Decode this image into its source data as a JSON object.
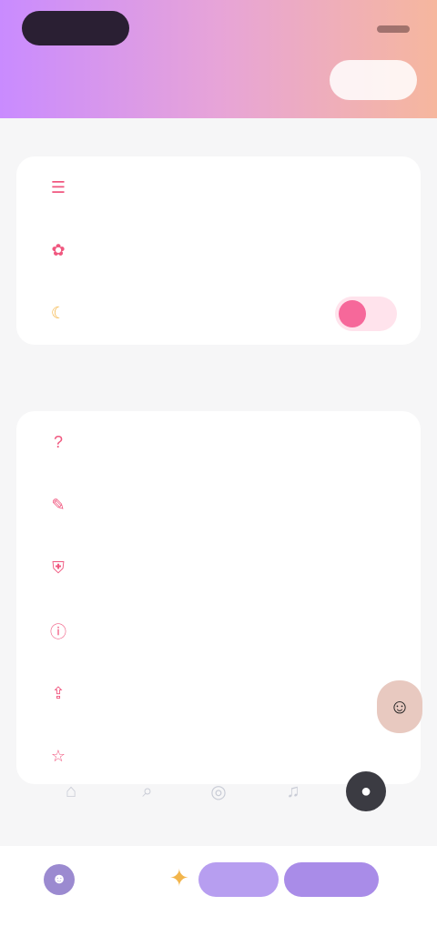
{
  "header": {
    "pill_label": "",
    "status_text": "",
    "title": "",
    "action_button": ""
  },
  "sections": [
    {
      "label": "",
      "rows": [
        {
          "icon": "list-icon",
          "label": ""
        },
        {
          "icon": "translate-icon",
          "label": "",
          "right_text": ""
        },
        {
          "icon": "moon-icon",
          "label": "",
          "toggle_on": true
        }
      ]
    },
    {
      "label": "",
      "rows": [
        {
          "icon": "help-icon",
          "label": ""
        },
        {
          "icon": "feedback-icon",
          "label": ""
        },
        {
          "icon": "shield-icon",
          "label": ""
        },
        {
          "icon": "info-icon",
          "label": ""
        },
        {
          "icon": "share-icon",
          "label": ""
        },
        {
          "icon": "star-icon",
          "label": ""
        }
      ]
    }
  ],
  "bottom": {
    "user_name": "",
    "button_1": "",
    "button_2": ""
  },
  "colors": {
    "accent": "#f0577f",
    "header_start": "#c98bff",
    "header_end": "#f6b79e",
    "purple_button": "#a98ce8"
  }
}
